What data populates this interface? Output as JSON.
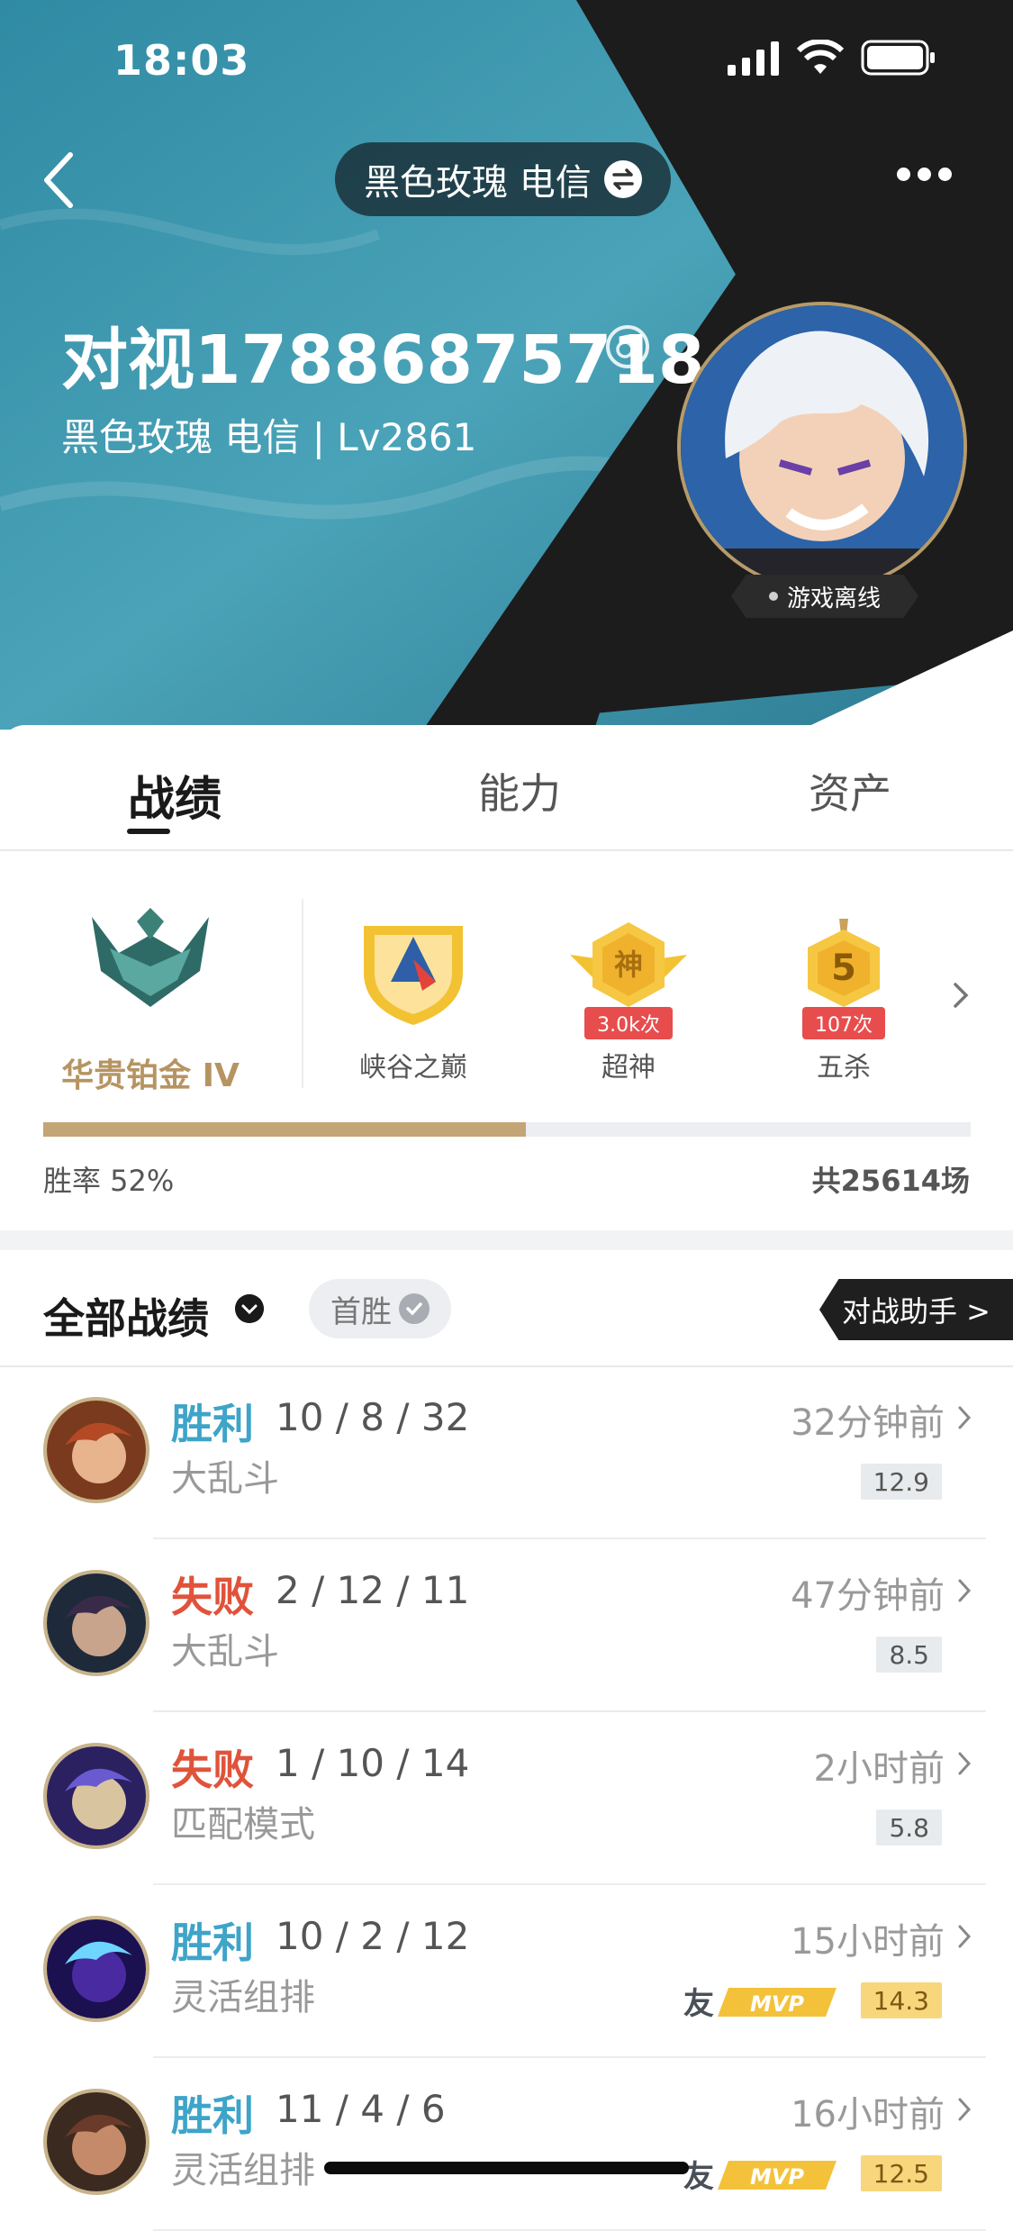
{
  "status_bar": {
    "time": "18:03"
  },
  "header": {
    "server_pill": "黑色玫瑰 电信",
    "player_name": "对视17886875718",
    "sub_info": "黑色玫瑰 电信 | Lv2861",
    "online_status": "游戏离线"
  },
  "tabs": [
    {
      "label": "战绩",
      "active": true
    },
    {
      "label": "能力",
      "active": false
    },
    {
      "label": "资产",
      "active": false
    }
  ],
  "rank": {
    "name": "华贵铂金 IV"
  },
  "honors": [
    {
      "label": "峡谷之巅",
      "icon": "summit-shield-icon",
      "badge": ""
    },
    {
      "label": "超神",
      "icon": "legendary-badge-icon",
      "badge": "3.0k次",
      "glyph": "神"
    },
    {
      "label": "五杀",
      "icon": "pentakill-badge-icon",
      "badge": "107次",
      "glyph": "5"
    }
  ],
  "stats": {
    "win_rate_text": "胜率 52%",
    "win_rate": 0.52,
    "total_text": "共25614场"
  },
  "filter": {
    "label": "全部战绩",
    "chip": "首胜",
    "helper": "对战助手 >"
  },
  "matches": [
    {
      "result": "胜利",
      "outcome": "win",
      "kda": "10 / 8 / 32",
      "mode": "大乱斗",
      "time": "32分钟前",
      "score": "12.9",
      "mvp": false,
      "hero": "hero-redhair"
    },
    {
      "result": "失败",
      "outcome": "loss",
      "kda": "2 / 12 / 11",
      "mode": "大乱斗",
      "time": "47分钟前",
      "score": "8.5",
      "mvp": false,
      "hero": "hero-dark"
    },
    {
      "result": "失败",
      "outcome": "loss",
      "kda": "1 / 10 / 14",
      "mode": "匹配模式",
      "time": "2小时前",
      "score": "5.8",
      "mvp": false,
      "hero": "hero-goggles"
    },
    {
      "result": "胜利",
      "outcome": "win",
      "kda": "10 / 2 / 12",
      "mode": "灵活组排",
      "time": "15小时前",
      "score": "14.3",
      "mvp": true,
      "mvp_text": "友 MVP",
      "hero": "hero-violet"
    },
    {
      "result": "胜利",
      "outcome": "win",
      "kda": "11 / 4 / 6",
      "mode": "灵活组排",
      "time": "16小时前",
      "score": "12.5",
      "mvp": true,
      "mvp_text": "友 MVP",
      "hero": "hero-brute"
    }
  ],
  "colors": {
    "win": "#3ea4c8",
    "loss": "#e0533a",
    "gold": "#c4a575",
    "header_teal": "#3b8fa5"
  }
}
